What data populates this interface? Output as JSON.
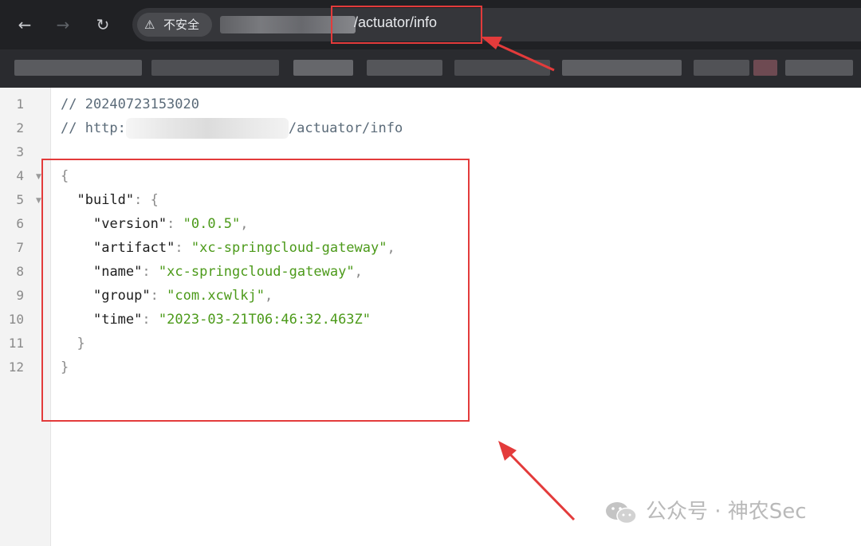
{
  "browser": {
    "nav": {
      "back_icon": "←",
      "forward_icon": "→",
      "reload_icon": "↻"
    },
    "address_bar": {
      "security_label": "不安全",
      "warning_icon": "⚠",
      "url_path": "/actuator/info"
    }
  },
  "lines": [
    "1",
    "2",
    "3",
    "4",
    "5",
    "6",
    "7",
    "8",
    "9",
    "10",
    "11",
    "12"
  ],
  "code": {
    "comment_timestamp": "// 20240723153020",
    "comment_url_prefix": "// http:",
    "comment_url_suffix": "/actuator/info",
    "open_brace": "{",
    "build_key": "build",
    "build_open": "{",
    "version_key": "version",
    "version_value": "0.0.5",
    "artifact_key": "artifact",
    "artifact_value": "xc-springcloud-gateway",
    "name_key": "name",
    "name_value": "xc-springcloud-gateway",
    "group_key": "group",
    "group_value": "com.xcwlkj",
    "time_key": "time",
    "time_value": "2023-03-21T06:46:32.463Z",
    "build_close": "}",
    "close_brace": "}"
  },
  "watermark": {
    "text": "公众号 · 神农Sec",
    "icon": "wechat-icon"
  },
  "colors": {
    "annotation": "#e33b3b",
    "string": "#4c9a1a",
    "chrome_bg": "#202124"
  }
}
